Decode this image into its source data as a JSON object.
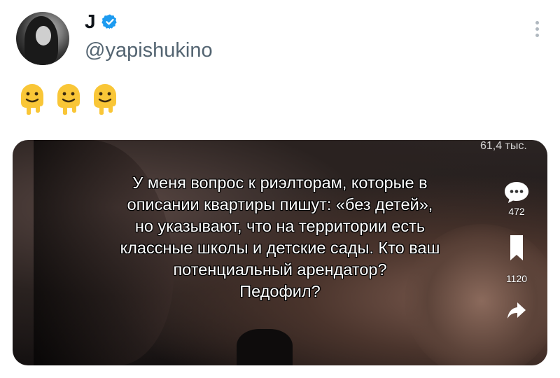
{
  "tweet": {
    "author": {
      "display_name": "J",
      "handle": "@yapishukino",
      "verified": true
    },
    "text_emojis": [
      "melting-face",
      "melting-face",
      "melting-face"
    ],
    "media": {
      "views": "61,4 тыс.",
      "overlay_lines": [
        "У меня вопрос к риэлторам, которые в",
        "описании квартиры пишут: «без детей»,",
        "но указывают, что на территории есть",
        "классные школы и детские сады. Кто ваш",
        "потенциальный арендатор?",
        "Педофил?"
      ],
      "comments": "472",
      "bookmarks": "1120"
    },
    "colors": {
      "verified": "#1d9bf0",
      "handle": "#536471",
      "name": "#0f1419"
    }
  }
}
